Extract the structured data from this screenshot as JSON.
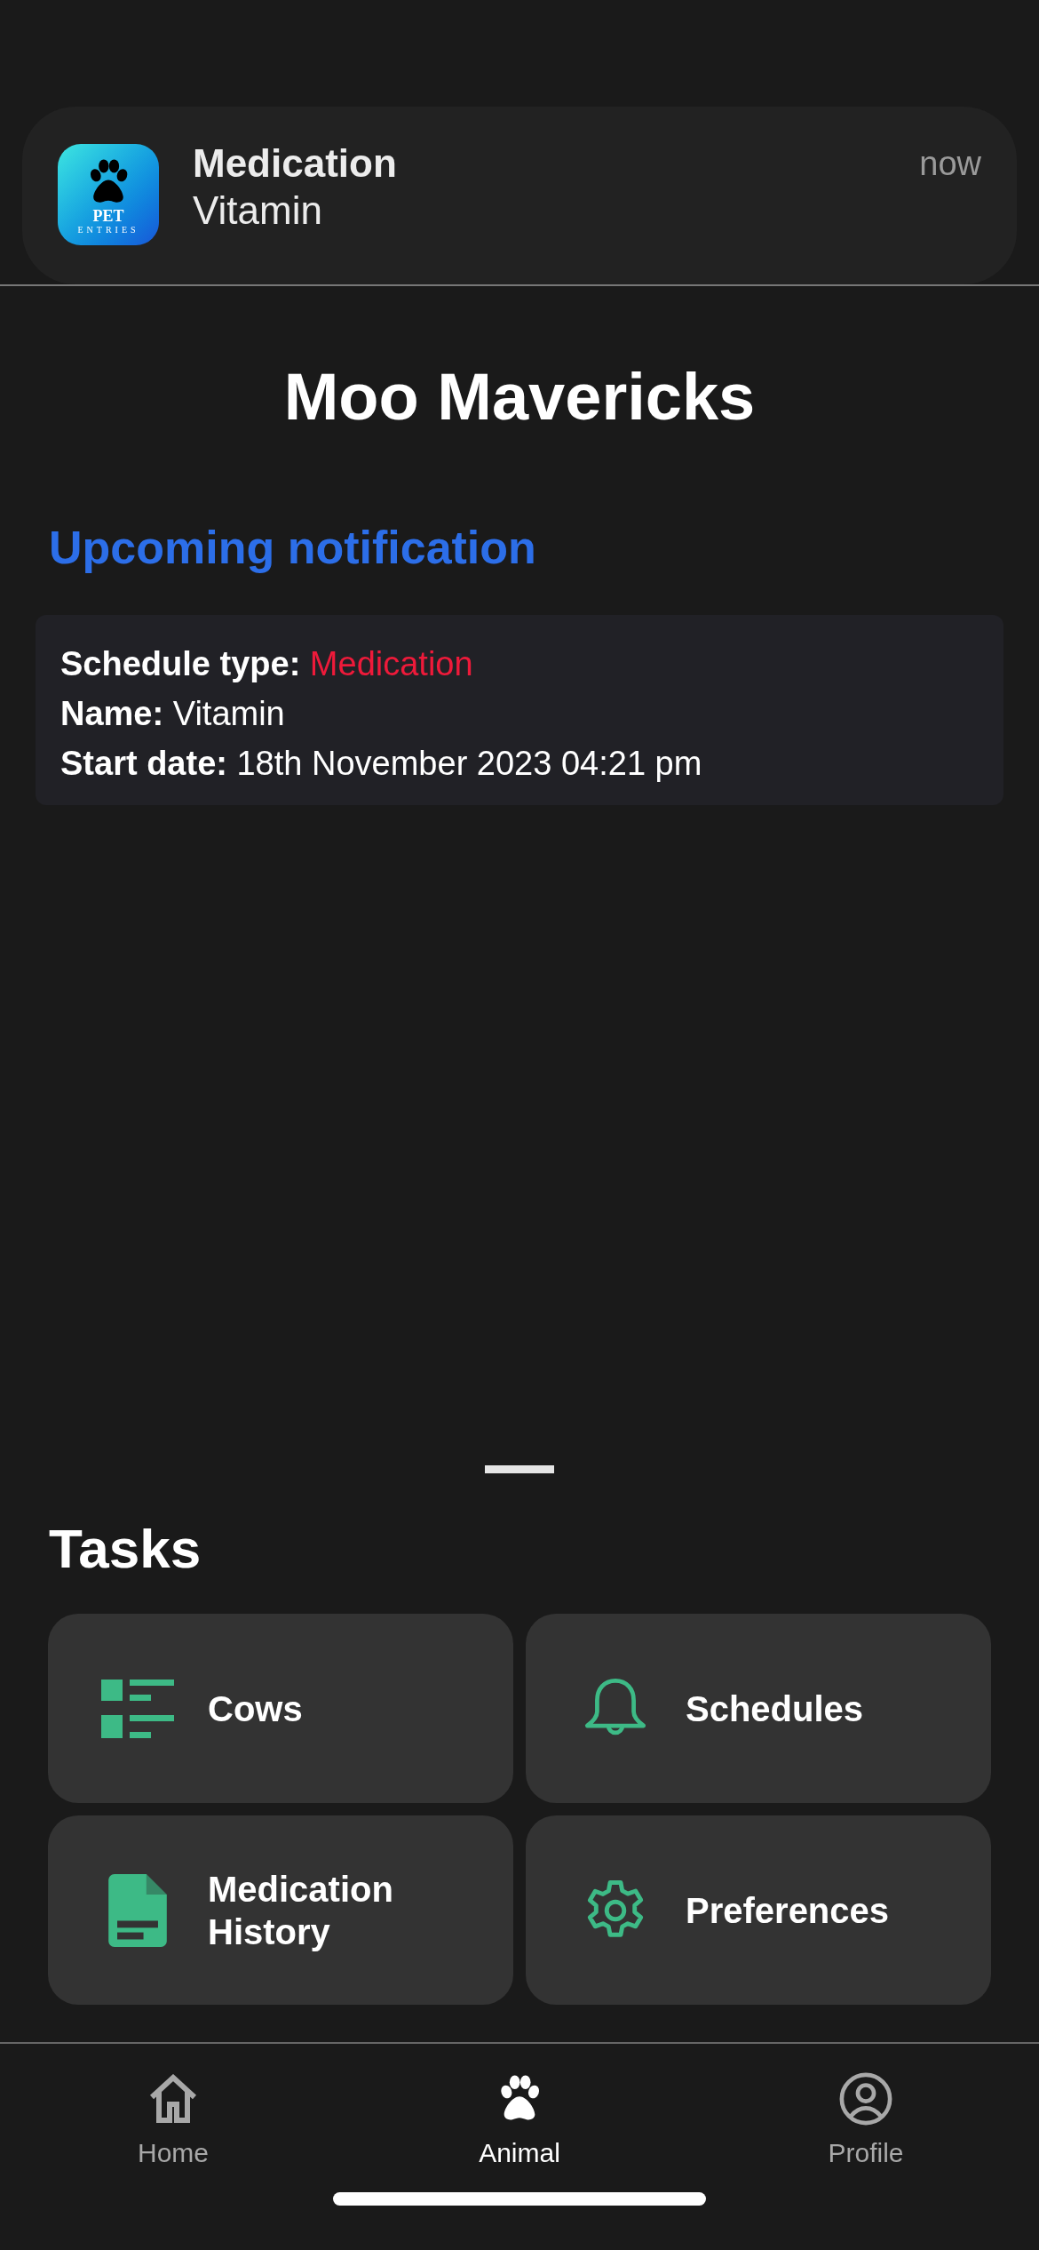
{
  "banner": {
    "app_icon": {
      "line_1": "PET",
      "line_2": "ENTRIES"
    },
    "title": "Medication",
    "body": "Vitamin",
    "time": "now"
  },
  "title": "Moo Mavericks",
  "upcoming": {
    "heading": "Upcoming notification",
    "rows": [
      {
        "label": "Schedule type:",
        "value": "Medication",
        "highlight": true
      },
      {
        "label": "Name:",
        "value": "Vitamin",
        "highlight": false
      },
      {
        "label": "Start date:",
        "value": "18th November 2023 04:21 pm",
        "highlight": false
      }
    ]
  },
  "tasks": {
    "heading": "Tasks",
    "items": [
      {
        "kind": "list",
        "label": "Cows"
      },
      {
        "kind": "bell",
        "label": "Schedules"
      },
      {
        "kind": "document",
        "label": "Medication History"
      },
      {
        "kind": "gear",
        "label": "Preferences"
      }
    ]
  },
  "tab_bar": [
    {
      "kind": "home",
      "label": "Home",
      "selected": false
    },
    {
      "kind": "paw",
      "label": "Animal",
      "selected": true
    },
    {
      "kind": "profile",
      "label": "Profile",
      "selected": false
    }
  ]
}
